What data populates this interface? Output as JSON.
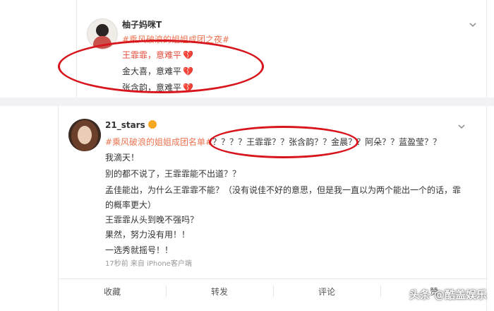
{
  "post1": {
    "username": "柚子妈咪T",
    "topic": "#乘风破浪的姐姐成团之夜#",
    "lines": [
      "王霏霏，意难平",
      "金大喜，意难平",
      "张含韵，意难平"
    ],
    "heart_icon": "broken-heart-icon"
  },
  "post2": {
    "username": "21_stars",
    "content": {
      "line1_topic": "#乘风破浪的姐姐成团名单#",
      "line1_rest": "？？？？王霏霏？？张含韵？？金晨？？阿朵？？蓝盈莹？？",
      "line2": "我滴天！",
      "line3": "别的都不说了，王霏霏能不出道？？",
      "line4": "孟佳能出，为什么王霏霏不能？（没有说佳不好的意思，但是我一直以为两个能出一个的话，霏",
      "line5": "的概率更大）",
      "line6": "王霏霏从头到晚不强吗？",
      "line7": "果然，努力没有用！！",
      "line8": "一选秀就摇号！！"
    },
    "meta": "17秒前  来自 iPhone客户端",
    "actions": [
      "收藏",
      "转发",
      "评论",
      "赞"
    ]
  },
  "watermark": "头条 @酷盖娱乐",
  "colors": {
    "topic": "#eb7350",
    "annotation": "#d8141c"
  }
}
